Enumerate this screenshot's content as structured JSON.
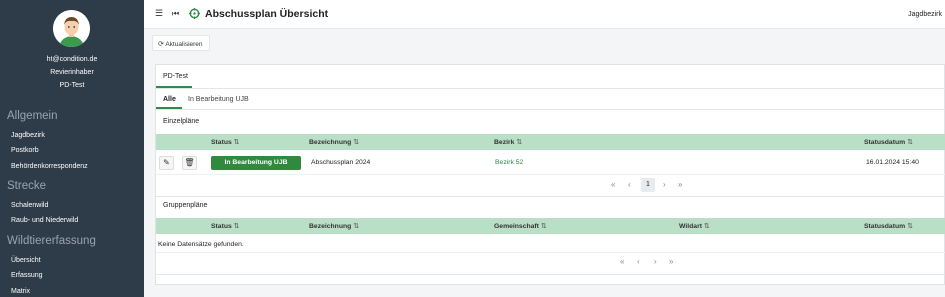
{
  "user": {
    "email": "ht@condition.de",
    "role": "Revierinhaber",
    "org": "PD-Test"
  },
  "sidebar": {
    "sections": [
      {
        "title": "Allgemein",
        "items": [
          "Jagdbezirk",
          "Postkorb",
          "Behördenkorrespondenz"
        ]
      },
      {
        "title": "Strecke",
        "items": [
          "Schalenwild",
          "Raub- und Niederwild"
        ]
      },
      {
        "title": "Wildtiererfassung",
        "items": [
          "Übersicht",
          "Erfassung",
          "Matrix"
        ]
      }
    ]
  },
  "topbar": {
    "title": "Abschussplan Übersicht",
    "right_label": "Jagdbezirk"
  },
  "toolbar": {
    "refresh_label": "Aktualisieren"
  },
  "tabs": {
    "main": "PD-Test",
    "sub": [
      "Alle",
      "In Bearbeitung UJB"
    ]
  },
  "einzel": {
    "title": "Einzelpläne",
    "columns": [
      "Status",
      "Bezeichnung",
      "Bezirk",
      "Statusdatum"
    ],
    "rows": [
      {
        "status": "In Bearbeitung UJB",
        "bezeichnung": "Abschussplan 2024",
        "bezirk": "Bezirk 52",
        "statusdatum": "16.01.2024 15:40"
      }
    ],
    "page": "1"
  },
  "gruppen": {
    "title": "Gruppenpläne",
    "columns": [
      "Status",
      "Bezeichnung",
      "Gemeinschaft",
      "Wildart",
      "Statusdatum"
    ],
    "empty": "Keine Datensätze gefunden."
  },
  "colors": {
    "sidebar": "#2e3b48",
    "accent": "#2f8a4a",
    "table_header": "#b9dfc7"
  }
}
